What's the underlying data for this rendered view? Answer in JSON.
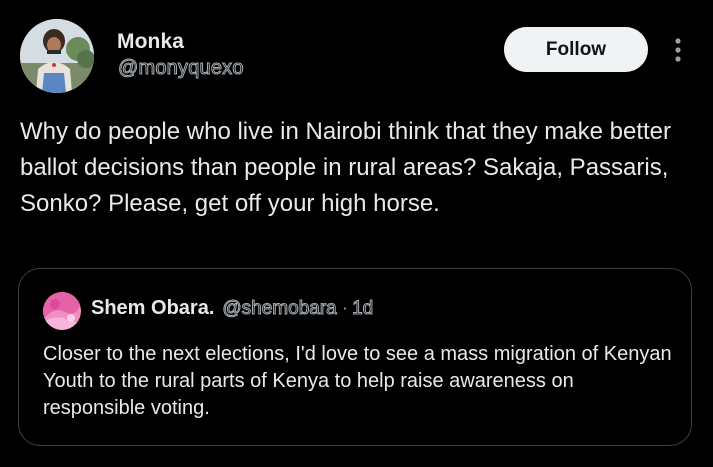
{
  "post": {
    "author": {
      "display_name": "Monka",
      "handle": "@monyquexo",
      "avatar_icon": "profile-photo"
    },
    "follow_label": "Follow",
    "more_icon": "more-vertical-icon",
    "text": "Why do people who live in Nairobi think that they make better ballot decisions than people in rural areas? Sakaja, Passaris, Sonko? Please, get off your high horse."
  },
  "quote": {
    "author": {
      "display_name": "Shem Obara.",
      "handle": "@shemobara",
      "avatar_icon": "pink-abstract-avatar"
    },
    "separator": "·",
    "time": "1d",
    "text": "Closer to the next elections, I'd love to see a mass migration of Kenyan Youth to the rural parts of Kenya to help raise awareness on responsible voting."
  },
  "colors": {
    "background": "#000000",
    "text_primary": "#e7e9ea",
    "text_secondary": "#a6acb1",
    "follow_bg": "#eff3f4",
    "border": "#3a3f44"
  }
}
